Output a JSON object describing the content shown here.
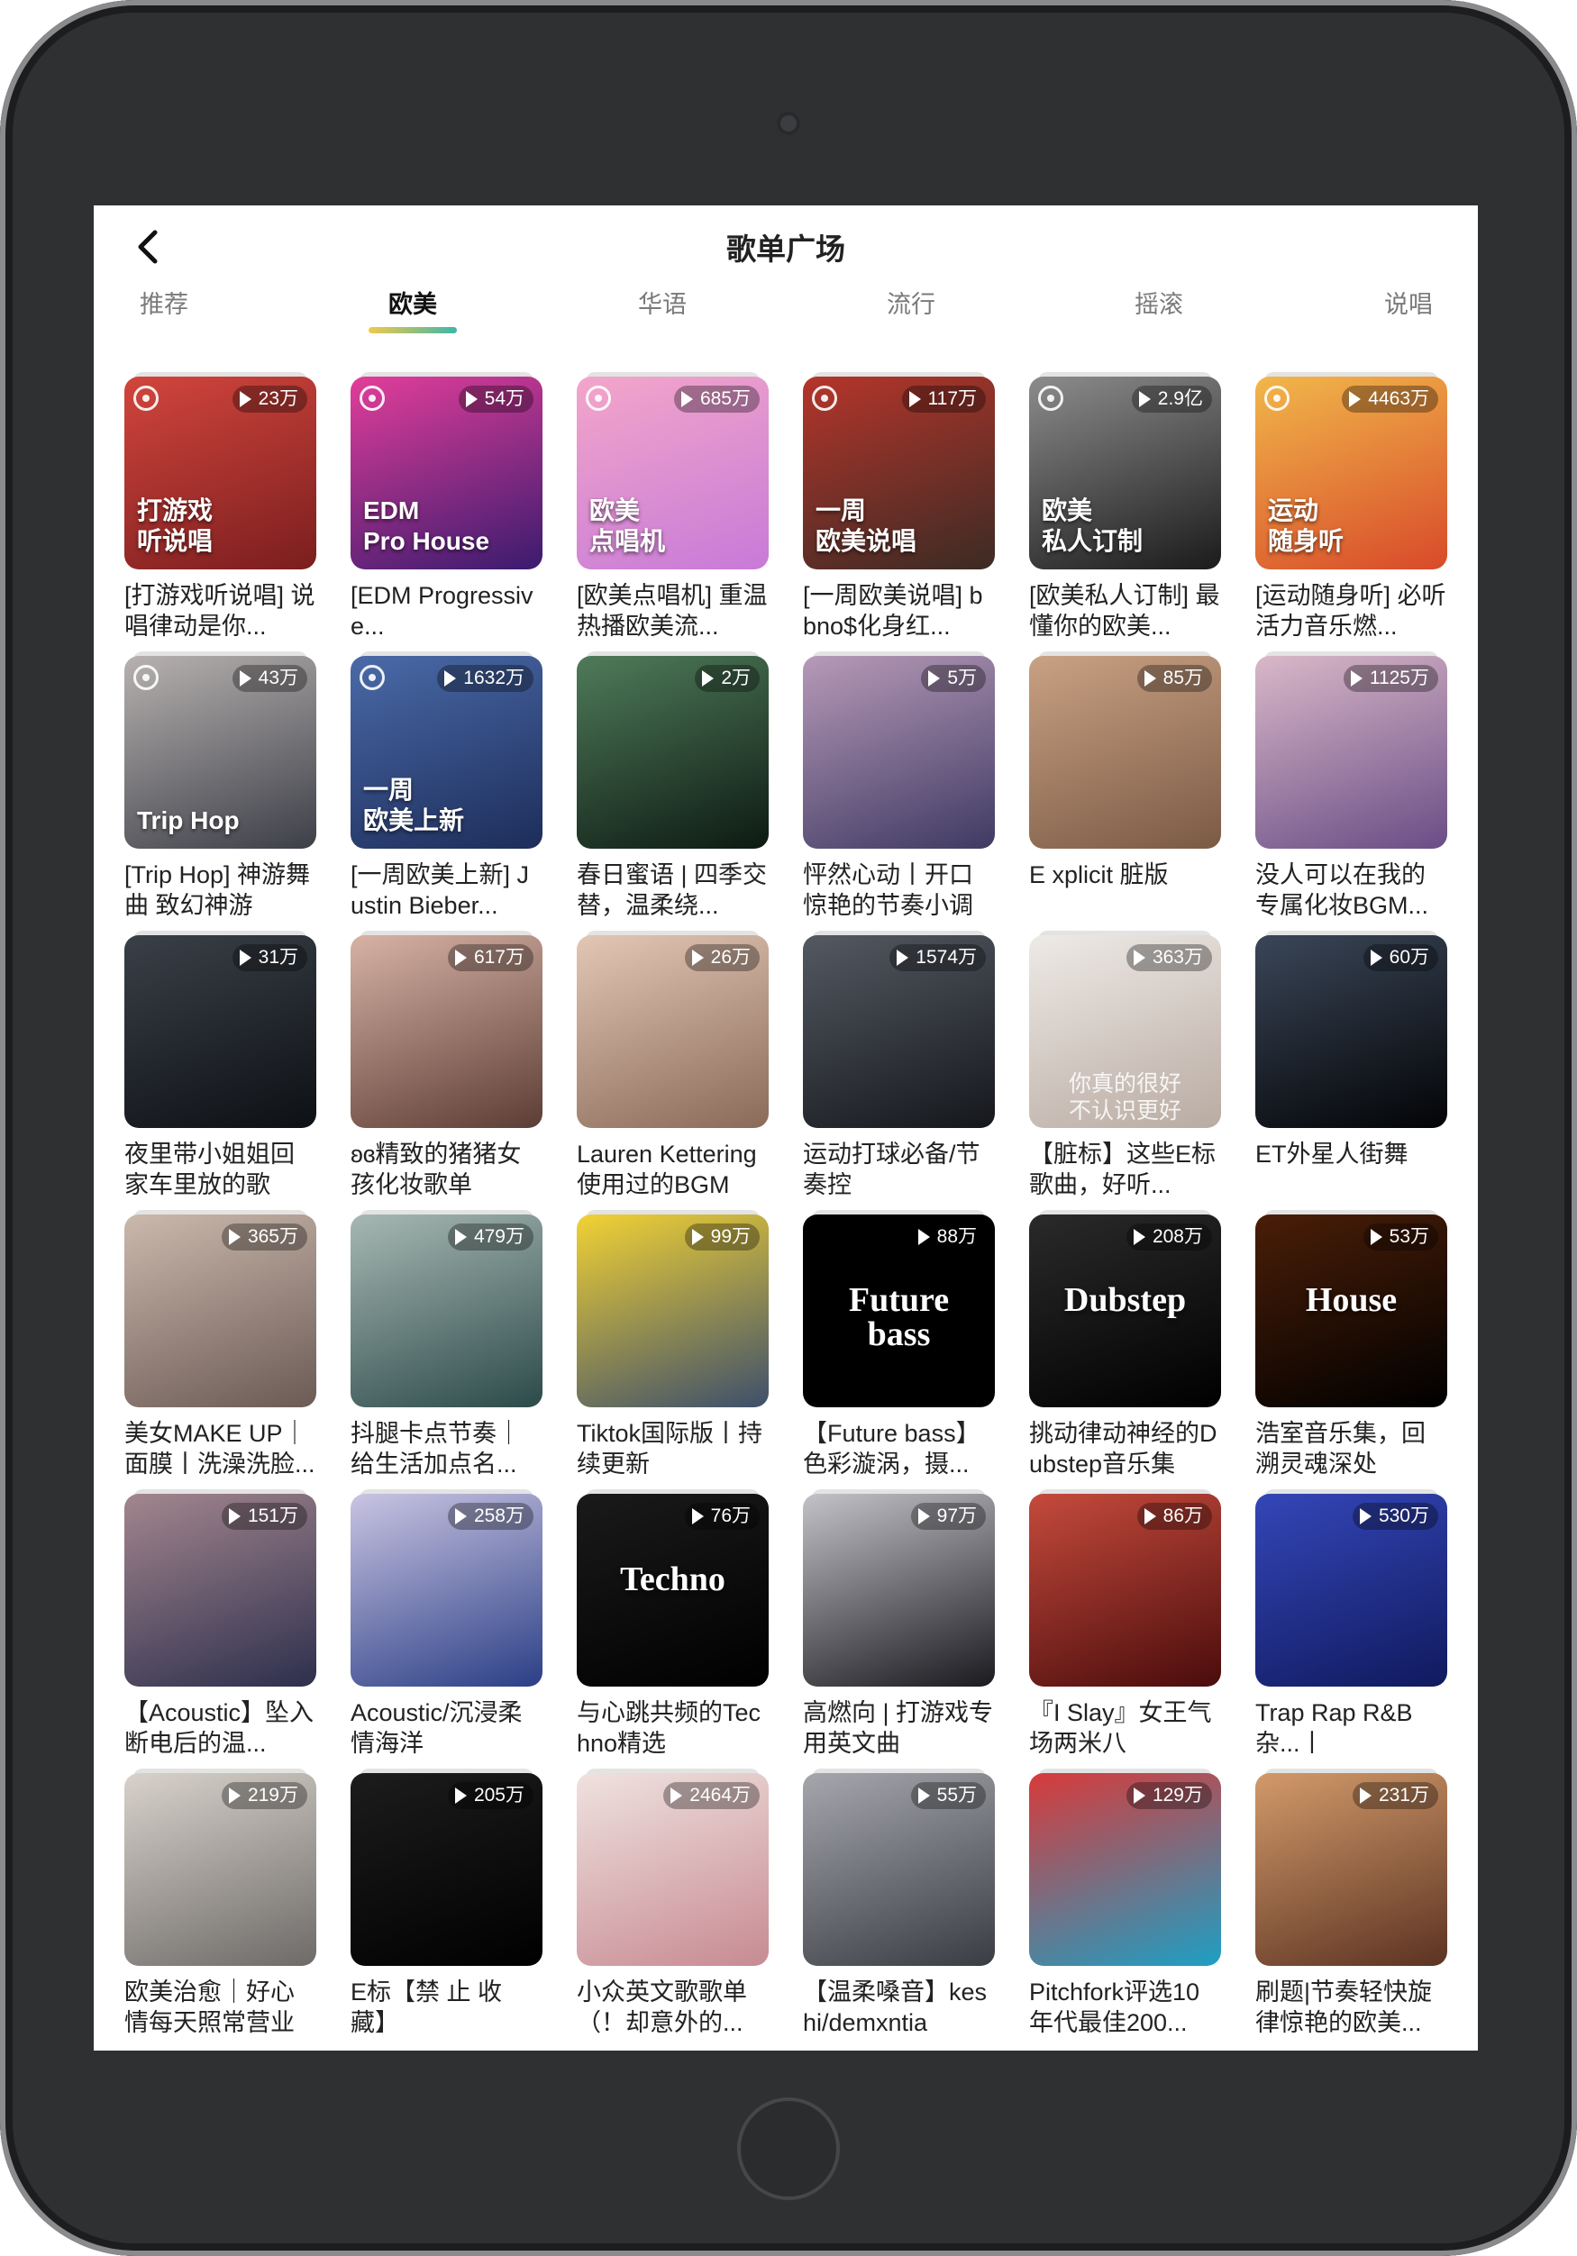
{
  "header": {
    "title": "歌单广场"
  },
  "tabs": [
    {
      "label": "推荐",
      "active": false
    },
    {
      "label": "欧美",
      "active": true
    },
    {
      "label": "华语",
      "active": false
    },
    {
      "label": "流行",
      "active": false
    },
    {
      "label": "摇滚",
      "active": false
    },
    {
      "label": "说唱",
      "active": false
    }
  ],
  "playlists": [
    {
      "count": "23万",
      "title": "[打游戏听说唱] 说唱律动是你...",
      "cover": "打游戏\n听说唱",
      "colors": [
        "#7a1e1e",
        "#d2453d"
      ],
      "badge": true
    },
    {
      "count": "54万",
      "title": "[EDM Progressive...",
      "cover": "EDM\nPro House",
      "colors": [
        "#3a1b6e",
        "#e23e9a"
      ],
      "badge": true
    },
    {
      "count": "685万",
      "title": "[欧美点唱机] 重温热播欧美流...",
      "cover": "欧美\n点唱机",
      "colors": [
        "#c77ad8",
        "#f3a6c9"
      ],
      "badge": true
    },
    {
      "count": "117万",
      "title": "[一周欧美说唱] bbno$化身红...",
      "cover": "一周\n欧美说唱",
      "colors": [
        "#3b2b24",
        "#b5352b"
      ],
      "badge": true
    },
    {
      "count": "2.9亿",
      "title": "[欧美私人订制] 最懂你的欧美...",
      "cover": "欧美\n私人订制",
      "colors": [
        "#1b1b1b",
        "#8c8c8c"
      ],
      "badge": true
    },
    {
      "count": "4463万",
      "title": "[运动随身听] 必听活力音乐燃...",
      "cover": "运动\n随身听",
      "colors": [
        "#d84a2a",
        "#f1b74a"
      ],
      "badge": true
    },
    {
      "count": "43万",
      "title": "[Trip Hop] 神游舞曲 致幻神游",
      "cover": "Trip Hop",
      "colors": [
        "#3d3f48",
        "#b7b2b0"
      ],
      "badge": true
    },
    {
      "count": "1632万",
      "title": "[一周欧美上新] Justin Bieber...",
      "cover": "一周\n欧美上新",
      "colors": [
        "#1d2d5a",
        "#4a6aa8"
      ],
      "badge": true
    },
    {
      "count": "2万",
      "title": "春日蜜语 | 四季交替，温柔绕...",
      "cover": "",
      "colors": [
        "#0d1a12",
        "#4f7b5a"
      ],
      "badge": false
    },
    {
      "count": "5万",
      "title": "怦然心动丨开口惊艳的节奏小调",
      "cover": "",
      "colors": [
        "#3f3a63",
        "#b79ab8"
      ],
      "badge": false
    },
    {
      "count": "85万",
      "title": "E xplicit 脏版",
      "cover": "",
      "colors": [
        "#7b5a45",
        "#c9a183"
      ],
      "badge": false
    },
    {
      "count": "1125万",
      "title": "没人可以在我的专属化妆BGM...",
      "cover": "",
      "colors": [
        "#6a4d86",
        "#d9b8c8"
      ],
      "badge": false
    },
    {
      "count": "31万",
      "title": "夜里带小姐姐回家车里放的歌",
      "cover": "",
      "colors": [
        "#0d1014",
        "#3a4048"
      ],
      "badge": false
    },
    {
      "count": "617万",
      "title": "ʚɞ精致的猪猪女孩化妆歌单",
      "cover": "",
      "colors": [
        "#5c3d35",
        "#d7b2a5"
      ],
      "badge": false
    },
    {
      "count": "26万",
      "title": "Lauren Kettering使用过的BGM",
      "cover": "",
      "colors": [
        "#8a6a58",
        "#e3c7b5"
      ],
      "badge": false
    },
    {
      "count": "1574万",
      "title": "运动打球必备/节奏控",
      "cover": "",
      "colors": [
        "#15171c",
        "#545962"
      ],
      "badge": false
    },
    {
      "count": "363万",
      "title": "【脏标】这些E标歌曲，好听...",
      "cover": "",
      "caption": "你真的很好\n不认识更好",
      "colors": [
        "#b9aba2",
        "#eeeae6"
      ],
      "badge": false
    },
    {
      "count": "60万",
      "title": "ET外星人街舞",
      "cover": "",
      "colors": [
        "#030406",
        "#3a4658"
      ],
      "badge": false
    },
    {
      "count": "365万",
      "title": "美女MAKE UP｜面膜丨洗澡洗脸...",
      "cover": "",
      "colors": [
        "#6b5a55",
        "#cbb9ad"
      ],
      "badge": false
    },
    {
      "count": "479万",
      "title": "抖腿卡点节奏｜给生活加点名...",
      "cover": "",
      "colors": [
        "#2c4a4a",
        "#a7b8b3"
      ],
      "badge": false
    },
    {
      "count": "99万",
      "title": "Tiktok国际版丨持续更新",
      "cover": "",
      "colors": [
        "#3d4f6b",
        "#f2d234"
      ],
      "badge": false
    },
    {
      "count": "88万",
      "title": "【Future bass】色彩漩涡，摄...",
      "cover": "",
      "center": "Future\nbass",
      "colors": [
        "#000000",
        "#000000"
      ],
      "badge": false
    },
    {
      "count": "208万",
      "title": "挑动律动神经的Dubstep音乐集",
      "cover": "",
      "center": "Dubstep",
      "colors": [
        "#000000",
        "#2a2a2a"
      ],
      "badge": false
    },
    {
      "count": "53万",
      "title": "浩室音乐集，回溯灵魂深处",
      "cover": "",
      "center": "House",
      "colors": [
        "#000000",
        "#4a1e08"
      ],
      "badge": false
    },
    {
      "count": "151万",
      "title": "【Acoustic】坠入断电后的温...",
      "cover": "",
      "colors": [
        "#2d2f4d",
        "#a3868e"
      ],
      "badge": false
    },
    {
      "count": "258万",
      "title": "Acoustic/沉浸柔情海洋",
      "cover": "",
      "colors": [
        "#2b3f86",
        "#c9c4e2"
      ],
      "badge": false
    },
    {
      "count": "76万",
      "title": "与心跳共频的Techno精选",
      "cover": "",
      "center": "Techno",
      "colors": [
        "#000000",
        "#1a1a1a"
      ],
      "badge": false
    },
    {
      "count": "97万",
      "title": "高燃向 | 打游戏专用英文曲",
      "cover": "",
      "colors": [
        "#1a1a1f",
        "#c2c2c8"
      ],
      "badge": false
    },
    {
      "count": "86万",
      "title": "『I Slay』女王气场两米八",
      "cover": "",
      "colors": [
        "#4a0c0c",
        "#c54a3c"
      ],
      "badge": false
    },
    {
      "count": "530万",
      "title": "Trap Rap R&B杂...丨",
      "cover": "",
      "colors": [
        "#101a5e",
        "#3446b8"
      ],
      "badge": false
    },
    {
      "count": "219万",
      "title": "欧美治愈｜好心情每天照常营业",
      "cover": "",
      "colors": [
        "#6d6a68",
        "#d8d2cb"
      ],
      "badge": false
    },
    {
      "count": "205万",
      "title": "E标【禁 止 收 藏】",
      "cover": "",
      "colors": [
        "#000000",
        "#1c1c1c"
      ],
      "badge": false
    },
    {
      "count": "2464万",
      "title": "小众英文歌歌单（！却意外的...",
      "cover": "",
      "colors": [
        "#c78a92",
        "#efe2df"
      ],
      "badge": false
    },
    {
      "count": "55万",
      "title": "【温柔嗓音】keshi/demxntia",
      "cover": "",
      "colors": [
        "#3a3c43",
        "#a5a7ad"
      ],
      "badge": false
    },
    {
      "count": "129万",
      "title": "Pitchfork评选10年代最佳200...",
      "cover": "",
      "colors": [
        "#1d9fc4",
        "#d83a3a"
      ],
      "badge": false
    },
    {
      "count": "231万",
      "title": "刷题|节奏轻快旋律惊艳的欧美...",
      "cover": "",
      "colors": [
        "#5c3322",
        "#d29a6a"
      ],
      "badge": false
    }
  ]
}
